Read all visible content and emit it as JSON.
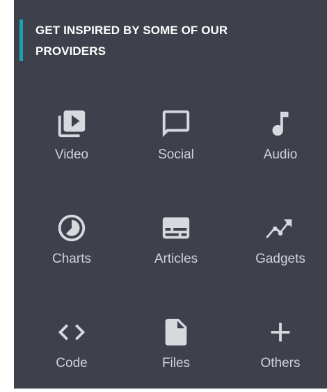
{
  "header": {
    "title_line1": "GET INSPIRED BY SOME OF OUR",
    "title_line2": "PROVIDERS"
  },
  "colors": {
    "panel_background": "#3e414b",
    "accent": "#17a3ad",
    "icon": "#d7d9de",
    "label": "#cfd2d8"
  },
  "providers": [
    {
      "label": "Video",
      "icon": "video-library-icon"
    },
    {
      "label": "Social",
      "icon": "chat-bubble-icon"
    },
    {
      "label": "Audio",
      "icon": "music-note-icon"
    },
    {
      "label": "Charts",
      "icon": "pie-chart-icon"
    },
    {
      "label": "Articles",
      "icon": "subtitles-icon"
    },
    {
      "label": "Gadgets",
      "icon": "trend-line-icon"
    },
    {
      "label": "Code",
      "icon": "code-icon"
    },
    {
      "label": "Files",
      "icon": "file-icon"
    },
    {
      "label": "Others",
      "icon": "plus-icon"
    }
  ]
}
